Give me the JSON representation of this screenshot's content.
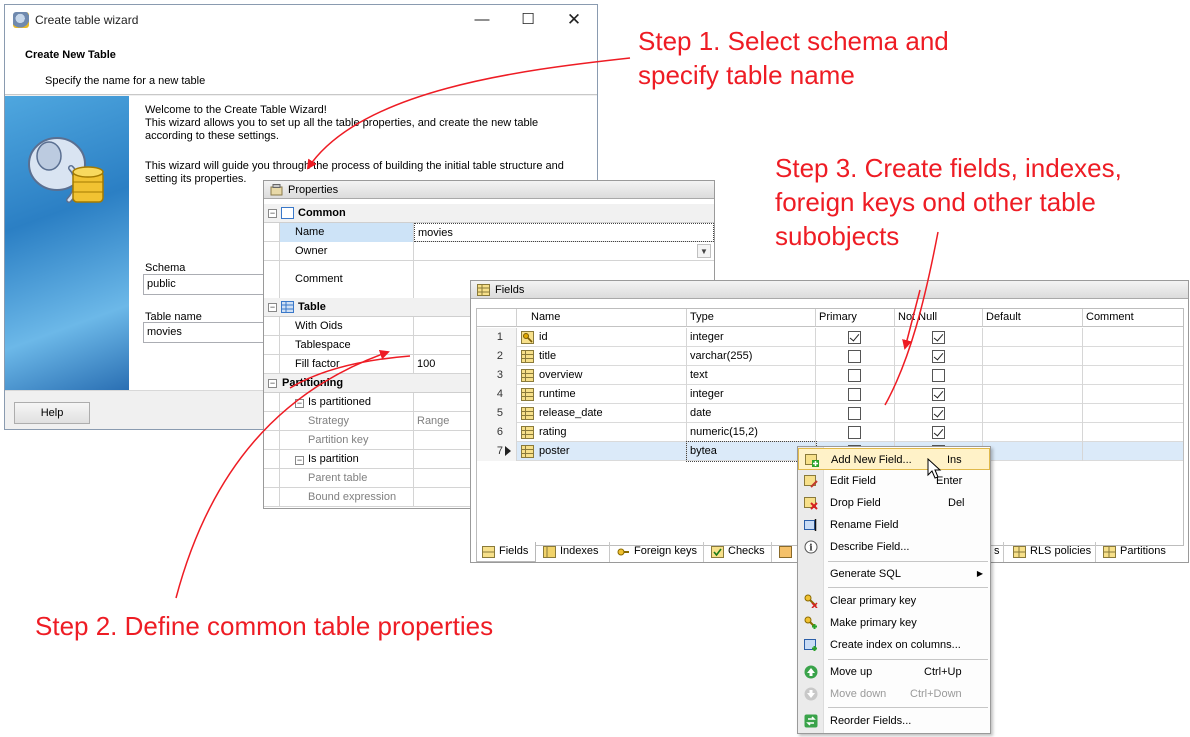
{
  "wizard": {
    "title": "Create table wizard",
    "heading": "Create New Table",
    "subheading": "Specify the name for a new table",
    "intro_line1": "Welcome to the Create Table Wizard!",
    "intro_line2": "This wizard allows you to set up all the table properties, and create the new table",
    "intro_line3": "according to these settings.",
    "guide_line1": "This wizard will guide you through the process of building the initial table structure and",
    "guide_line2": "setting its properties.",
    "schema_label": "Schema",
    "schema_value": "public",
    "table_name_label": "Table name",
    "table_name_value": "movies",
    "help_button": "Help",
    "window_controls": {
      "minimize": "—",
      "maximize": "☐",
      "close": "✕"
    }
  },
  "properties": {
    "title": "Properties",
    "categories": {
      "common": "Common",
      "table": "Table",
      "partitioning": "Partitioning"
    },
    "rows": {
      "name": {
        "label": "Name",
        "value": "movies"
      },
      "owner": {
        "label": "Owner",
        "value": ""
      },
      "comment": {
        "label": "Comment",
        "value": ""
      },
      "with_oids": {
        "label": "With Oids",
        "value": ""
      },
      "tablespace": {
        "label": "Tablespace",
        "value": ""
      },
      "fill_factor": {
        "label": "Fill factor",
        "value": "100"
      },
      "is_partitioned": {
        "label": "Is partitioned",
        "value": ""
      },
      "strategy": {
        "label": "Strategy",
        "value": "Range"
      },
      "partition_key": {
        "label": "Partition key",
        "value": ""
      },
      "is_partition": {
        "label": "Is partition",
        "value": ""
      },
      "parent_table": {
        "label": "Parent table",
        "value": ""
      },
      "bound_expression": {
        "label": "Bound expression",
        "value": ""
      }
    }
  },
  "fields_panel": {
    "title": "Fields",
    "columns": [
      "Name",
      "Type",
      "Primary",
      "Not Null",
      "Default",
      "Comment"
    ],
    "rows": [
      {
        "num": "1",
        "name": "id",
        "type": "integer",
        "primary": true,
        "not_null": true,
        "icon": "primary-key-field-icon"
      },
      {
        "num": "2",
        "name": "title",
        "type": "varchar(255)",
        "primary": false,
        "not_null": true,
        "icon": "field-icon"
      },
      {
        "num": "3",
        "name": "overview",
        "type": "text",
        "primary": false,
        "not_null": false,
        "icon": "field-icon"
      },
      {
        "num": "4",
        "name": "runtime",
        "type": "integer",
        "primary": false,
        "not_null": true,
        "icon": "field-icon"
      },
      {
        "num": "5",
        "name": "release_date",
        "type": "date",
        "primary": false,
        "not_null": true,
        "icon": "field-icon"
      },
      {
        "num": "6",
        "name": "rating",
        "type": "numeric(15,2)",
        "primary": false,
        "not_null": true,
        "icon": "field-icon"
      },
      {
        "num": "7",
        "name": "poster",
        "type": "bytea",
        "primary": false,
        "not_null": false,
        "icon": "field-icon"
      }
    ],
    "tabs": [
      "Fields",
      "Indexes",
      "Foreign keys",
      "Checks",
      "",
      "s",
      "RLS policies",
      "Partitions"
    ]
  },
  "context_menu": {
    "items": [
      {
        "label": "Add New Field...",
        "shortcut": "Ins",
        "icon": "add-field-icon"
      },
      {
        "label": "Edit Field",
        "shortcut": "Enter",
        "icon": "edit-field-icon"
      },
      {
        "label": "Drop Field",
        "shortcut": "Del",
        "icon": "drop-field-icon"
      },
      {
        "label": "Rename Field",
        "shortcut": "",
        "icon": "rename-field-icon"
      },
      {
        "label": "Describe Field...",
        "shortcut": "",
        "icon": "info-icon"
      },
      {
        "label": "Generate SQL",
        "shortcut": "",
        "icon": ""
      },
      {
        "label": "Clear primary key",
        "shortcut": "",
        "icon": "clear-key-icon"
      },
      {
        "label": "Make primary key",
        "shortcut": "",
        "icon": "make-key-icon"
      },
      {
        "label": "Create index on columns...",
        "shortcut": "",
        "icon": "create-index-icon"
      },
      {
        "label": "Move up",
        "shortcut": "Ctrl+Up",
        "icon": "move-up-icon"
      },
      {
        "label": "Move down",
        "shortcut": "Ctrl+Down",
        "icon": "move-down-icon"
      },
      {
        "label": "Reorder Fields...",
        "shortcut": "",
        "icon": "reorder-icon"
      }
    ],
    "submenu_arrow": "▶"
  },
  "annotations": {
    "step1_line1": "Step 1. Select schema and",
    "step1_line2": "specify table name",
    "step2": "Step 2. Define common table properties",
    "step3_line1": "Step 3. Create fields, indexes,",
    "step3_line2": "foreign keys ond other table",
    "step3_line3": "subobjects"
  },
  "colors": {
    "annotation": "#ee1c24",
    "selection": "#cde3f7",
    "menu_highlight": "#fff2c8"
  }
}
